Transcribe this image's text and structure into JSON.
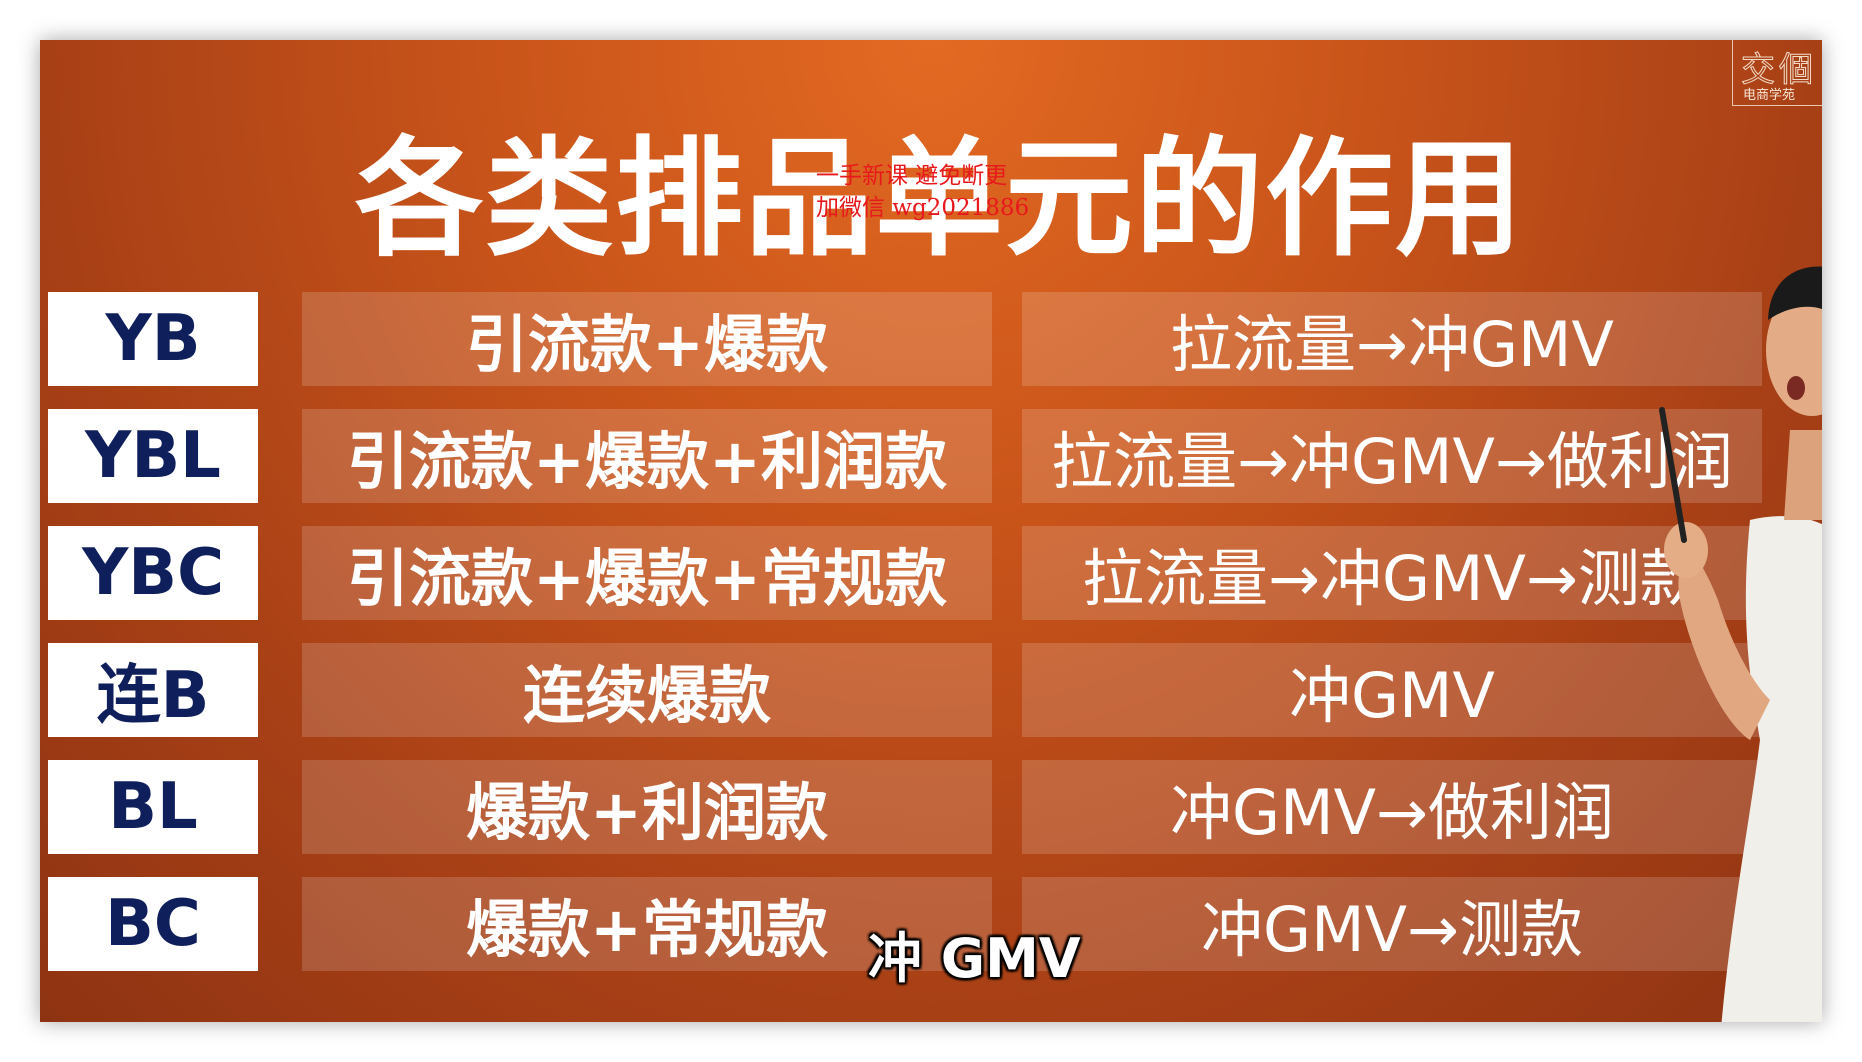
{
  "logo": {
    "mark": "交個",
    "text": "电商学苑"
  },
  "slide": {
    "title": "各类排品单元的作用"
  },
  "watermark": {
    "line1": "一手新课 避免断更",
    "line2": "加微信 wg2021886"
  },
  "rows": [
    {
      "label": "YB",
      "products": "引流款+爆款",
      "effect": "拉流量→冲GMV"
    },
    {
      "label": "YBL",
      "products": "引流款+爆款+利润款",
      "effect": "拉流量→冲GMV→做利润"
    },
    {
      "label": "YBC",
      "products": "引流款+爆款+常规款",
      "effect": "拉流量→冲GMV→测款"
    },
    {
      "label": "连B",
      "products": "连续爆款",
      "effect": "冲GMV"
    },
    {
      "label": "BL",
      "products": "爆款+利润款",
      "effect": "冲GMV→做利润"
    },
    {
      "label": "BC",
      "products": "爆款+常规款",
      "effect": "冲GMV→测款"
    }
  ],
  "subtitle": {
    "text": "冲 GMV"
  },
  "colors": {
    "background": "#c9541a",
    "label_text": "#0f1f5c",
    "watermark": "#e8191c"
  }
}
